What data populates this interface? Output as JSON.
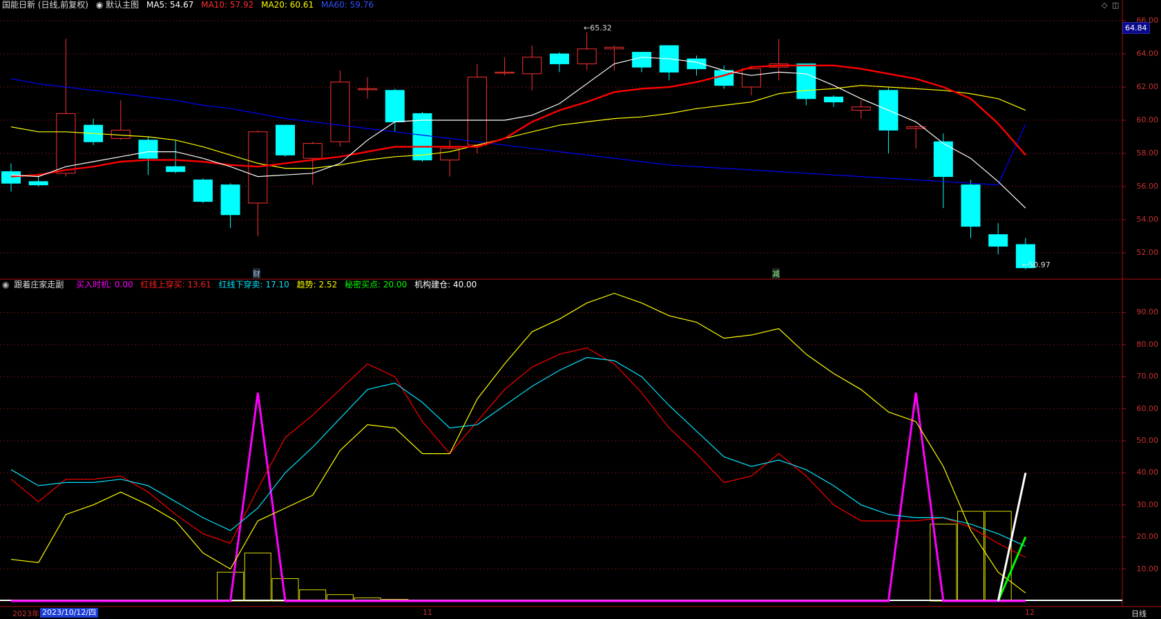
{
  "header": {
    "stock_label": "国能日新 (日线,前复权)",
    "theme_label": "默认主图",
    "ma5": "MA5: 54.67",
    "ma10": "MA10: 57.92",
    "ma20": "MA20: 60.61",
    "ma60": "MA60: 59.76",
    "current_price_tag": "64.84"
  },
  "sub_header": {
    "indicator_name": "跟着庄家走副",
    "buy_timing": "买入时机: 0.00",
    "red_up": "红线上穿买: 13.61",
    "red_down": "红线下穿卖: 17.10",
    "trend": "趋势: 2.52",
    "secret_buy": "秘密买点: 20.00",
    "inst_build": "机构建仓: 40.00"
  },
  "price_axis": [
    "66.00",
    "64.00",
    "62.00",
    "60.00",
    "58.00",
    "56.00",
    "54.00",
    "52.00"
  ],
  "indicator_axis": [
    "90.00",
    "80.00",
    "70.00",
    "60.00",
    "50.00",
    "40.00",
    "30.00",
    "20.00",
    "10.00"
  ],
  "annotations": {
    "high": "65.32",
    "low": "50.97",
    "event1": "财",
    "event2": "减"
  },
  "footer": {
    "year": "2023年",
    "date": "2023/10/12/四",
    "month11": "11",
    "month12": "12",
    "period": "日线"
  },
  "colors": {
    "up": "#ff3232",
    "down": "#00ffff",
    "ma5": "#ffffff",
    "ma10": "#ff0000",
    "ma20": "#ffff00",
    "ma60": "#0000ff",
    "buy_timing": "#ff00ff",
    "red_up": "#ff0000",
    "red_down": "#00e5ff",
    "trend": "#ffff00",
    "secret_buy": "#00ff00",
    "inst_build": "#ffffff"
  },
  "chart_data": [
    {
      "type": "candlestick",
      "title": "国能日新 (日线,前复权)",
      "ylim": [
        50.5,
        66.5
      ],
      "candles": [
        [
          56.9,
          56.2,
          57.4,
          55.7
        ],
        [
          56.3,
          56.1,
          56.7,
          56.0
        ],
        [
          56.8,
          60.4,
          64.9,
          56.6
        ],
        [
          59.7,
          58.7,
          60.1,
          58.5
        ],
        [
          58.9,
          59.4,
          61.2,
          58.8
        ],
        [
          58.8,
          57.7,
          59.0,
          56.7
        ],
        [
          57.2,
          56.9,
          58.8,
          56.8
        ],
        [
          56.4,
          55.1,
          56.5,
          55.0
        ],
        [
          56.1,
          54.3,
          56.2,
          53.5
        ],
        [
          55.0,
          59.3,
          59.4,
          53.0
        ],
        [
          59.7,
          57.9,
          59.7,
          57.8
        ],
        [
          57.7,
          58.6,
          58.7,
          56.1
        ],
        [
          58.7,
          62.3,
          63.0,
          58.4
        ],
        [
          61.9,
          61.9,
          62.6,
          61.3
        ],
        [
          61.8,
          59.9,
          61.9,
          59.3
        ],
        [
          60.4,
          57.6,
          60.5,
          57.5
        ],
        [
          57.6,
          58.3,
          58.8,
          56.6
        ],
        [
          58.5,
          62.6,
          63.4,
          58.0
        ],
        [
          62.9,
          62.9,
          63.8,
          62.7
        ],
        [
          62.8,
          63.8,
          64.5,
          61.8
        ],
        [
          64.0,
          63.4,
          64.1,
          62.9
        ],
        [
          63.4,
          64.3,
          65.3,
          63.0
        ],
        [
          64.3,
          64.4,
          64.5,
          63.0
        ],
        [
          64.1,
          63.2,
          64.1,
          62.9
        ],
        [
          64.5,
          62.9,
          64.5,
          62.4
        ],
        [
          63.7,
          63.1,
          63.9,
          62.7
        ],
        [
          63.0,
          62.1,
          63.3,
          61.9
        ],
        [
          62.0,
          63.1,
          63.3,
          61.5
        ],
        [
          63.2,
          63.4,
          64.9,
          62.4
        ],
        [
          63.4,
          61.3,
          63.4,
          60.9
        ],
        [
          61.4,
          61.1,
          61.5,
          60.8
        ],
        [
          60.6,
          60.8,
          61.2,
          60.1
        ],
        [
          61.8,
          59.4,
          62.0,
          58.0
        ],
        [
          59.5,
          59.6,
          59.7,
          58.3
        ],
        [
          58.7,
          56.6,
          59.2,
          54.7
        ],
        [
          56.1,
          53.6,
          56.4,
          52.9
        ],
        [
          53.1,
          52.4,
          53.8,
          51.9
        ],
        [
          52.5,
          51.1,
          52.9,
          51.0
        ]
      ],
      "ma5": [
        56.7,
        56.6,
        57.2,
        57.5,
        57.8,
        58.1,
        58.1,
        57.7,
        57.2,
        56.6,
        56.7,
        56.8,
        57.4,
        58.8,
        59.9,
        60.0,
        60.0,
        60.0,
        60.0,
        60.3,
        61.0,
        62.2,
        63.4,
        63.8,
        63.7,
        63.5,
        63.0,
        62.7,
        62.9,
        62.8,
        62.1,
        61.3,
        60.6,
        59.9,
        58.6,
        57.7,
        56.3,
        54.7
      ],
      "ma10": [
        56.6,
        56.7,
        57.0,
        57.2,
        57.5,
        57.6,
        57.6,
        57.5,
        57.3,
        57.2,
        57.4,
        57.6,
        57.8,
        58.1,
        58.4,
        58.4,
        58.4,
        58.4,
        58.9,
        59.9,
        60.6,
        61.1,
        61.7,
        61.9,
        62.0,
        62.3,
        62.7,
        63.2,
        63.3,
        63.3,
        63.3,
        63.1,
        62.8,
        62.5,
        62.0,
        61.3,
        59.8,
        57.9
      ],
      "ma20": [
        59.6,
        59.3,
        59.3,
        59.2,
        59.1,
        59.0,
        58.8,
        58.4,
        57.9,
        57.4,
        57.1,
        57.1,
        57.3,
        57.6,
        57.8,
        57.9,
        58.1,
        58.5,
        58.9,
        59.3,
        59.7,
        59.9,
        60.1,
        60.2,
        60.4,
        60.7,
        60.9,
        61.1,
        61.6,
        61.8,
        61.9,
        62.1,
        62.0,
        61.9,
        61.8,
        61.6,
        61.3,
        60.6
      ],
      "ma60": [
        62.5,
        62.2,
        62.0,
        61.8,
        61.6,
        61.4,
        61.2,
        60.9,
        60.7,
        60.4,
        60.1,
        59.9,
        59.7,
        59.5,
        59.3,
        59.1,
        58.9,
        58.7,
        58.5,
        58.3,
        58.1,
        57.9,
        57.7,
        57.5,
        57.3,
        57.2,
        57.1,
        57.0,
        56.9,
        56.8,
        56.7,
        56.6,
        56.5,
        56.4,
        56.3,
        56.2,
        56.1,
        59.76
      ]
    },
    {
      "type": "line",
      "title": "跟着庄家走副",
      "ylim": [
        0,
        97
      ],
      "series": [
        {
          "name": "买入时机",
          "values": [
            0,
            0,
            0,
            0,
            0,
            0,
            0,
            0,
            0,
            65,
            0,
            0,
            0,
            0,
            0,
            0,
            0,
            0,
            0,
            0,
            0,
            0,
            0,
            0,
            0,
            0,
            0,
            0,
            0,
            0,
            0,
            0,
            0,
            65,
            0,
            0,
            0,
            0
          ]
        },
        {
          "name": "红线上穿买",
          "values": [
            38,
            31,
            38,
            38,
            39,
            34,
            27,
            21,
            18,
            35,
            51,
            58,
            66,
            74,
            70,
            56,
            46,
            56,
            66,
            73,
            77,
            79,
            74,
            65,
            54,
            46,
            37,
            39,
            46,
            39,
            30,
            25,
            25,
            25,
            26,
            23,
            18,
            13.61
          ]
        },
        {
          "name": "红线下穿卖",
          "values": [
            41,
            36,
            37,
            37,
            38,
            36,
            31,
            26,
            22,
            29,
            40,
            48,
            57,
            66,
            68,
            62,
            54,
            55,
            61,
            67,
            72,
            76,
            75,
            70,
            61,
            53,
            45,
            42,
            44,
            41,
            36,
            30,
            27,
            26,
            26,
            24,
            21,
            17.1
          ]
        },
        {
          "name": "趋势",
          "values": [
            13,
            12,
            27,
            30,
            34,
            30,
            25,
            15,
            10,
            25,
            29,
            33,
            47,
            55,
            54,
            46,
            46,
            63,
            74,
            84,
            88,
            93,
            96,
            93,
            89,
            87,
            82,
            83,
            85,
            77,
            71,
            66,
            59,
            56,
            42,
            22,
            9,
            2.52
          ]
        },
        {
          "name": "秘密买点",
          "values": [
            0,
            0,
            0,
            0,
            0,
            0,
            0,
            0,
            0,
            0,
            0,
            0,
            0,
            0,
            0,
            0,
            0,
            0,
            0,
            0,
            0,
            0,
            0,
            0,
            0,
            0,
            0,
            0,
            0,
            0,
            0,
            0,
            0,
            0,
            0,
            0,
            0,
            20
          ]
        },
        {
          "name": "机构建仓",
          "values": [
            0,
            0,
            0,
            0,
            0,
            0,
            0,
            0,
            0,
            0,
            0,
            0,
            0,
            0,
            0,
            0,
            0,
            0,
            0,
            0,
            0,
            0,
            0,
            0,
            0,
            0,
            0,
            0,
            0,
            0,
            0,
            0,
            0,
            0,
            0,
            0,
            0,
            40
          ]
        }
      ],
      "bars": [
        0,
        0,
        0,
        0,
        0,
        0,
        0,
        0,
        9,
        15,
        7,
        3.5,
        2,
        1,
        0.5,
        0,
        0,
        0,
        0,
        0,
        0,
        0,
        0,
        0,
        0,
        0,
        0,
        0,
        0,
        0,
        0,
        0,
        0,
        0,
        24,
        28,
        28,
        0
      ]
    }
  ]
}
